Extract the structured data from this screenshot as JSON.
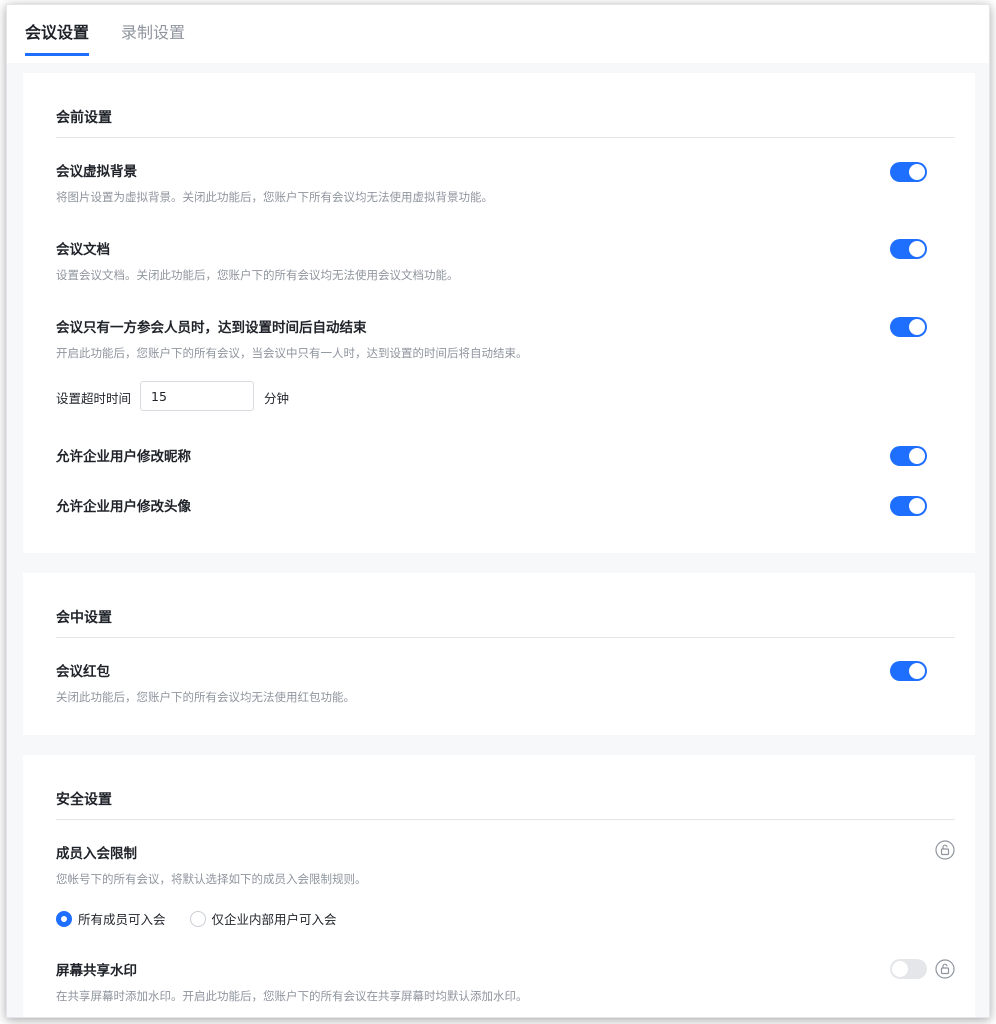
{
  "tabs": [
    {
      "label": "会议设置",
      "active": true
    },
    {
      "label": "录制设置",
      "active": false
    }
  ],
  "pre_meeting": {
    "title": "会前设置",
    "virtual_bg": {
      "title": "会议虚拟背景",
      "desc": "将图片设置为虚拟背景。关闭此功能后，您账户下所有会议均无法使用虚拟背景功能。",
      "enabled": true
    },
    "documents": {
      "title": "会议文档",
      "desc": "设置会议文档。关闭此功能后，您账户下的所有会议均无法使用会议文档功能。",
      "enabled": true
    },
    "auto_end": {
      "title": "会议只有一方参会人员时，达到设置时间后自动结束",
      "desc": "开启此功能后，您账户下的所有会议，当会议中只有一人时，达到设置的时间后将自动结束。",
      "enabled": true
    },
    "timeout": {
      "label": "设置超时时间",
      "value": "15",
      "unit": "分钟"
    },
    "nickname": {
      "title": "允许企业用户修改昵称",
      "enabled": true
    },
    "avatar": {
      "title": "允许企业用户修改头像",
      "enabled": true
    }
  },
  "in_meeting": {
    "title": "会中设置",
    "red_packet": {
      "title": "会议红包",
      "desc": "关闭此功能后，您账户下的所有会议均无法使用红包功能。",
      "enabled": true
    }
  },
  "security": {
    "title": "安全设置",
    "join_limit": {
      "title": "成员入会限制",
      "desc": "您帐号下的所有会议，将默认选择如下的成员入会限制规则。",
      "options": [
        "所有成员可入会",
        "仅企业内部用户可入会"
      ],
      "selected": 0
    },
    "watermark": {
      "title": "屏幕共享水印",
      "desc": "在共享屏幕时添加水印。开启此功能后，您账户下的所有会议在共享屏幕时均默认添加水印。",
      "enabled": false
    }
  },
  "colors": {
    "accent": "#1f6fff",
    "toggle_off": "#e4e6ea",
    "muted_text": "#8f959e"
  }
}
